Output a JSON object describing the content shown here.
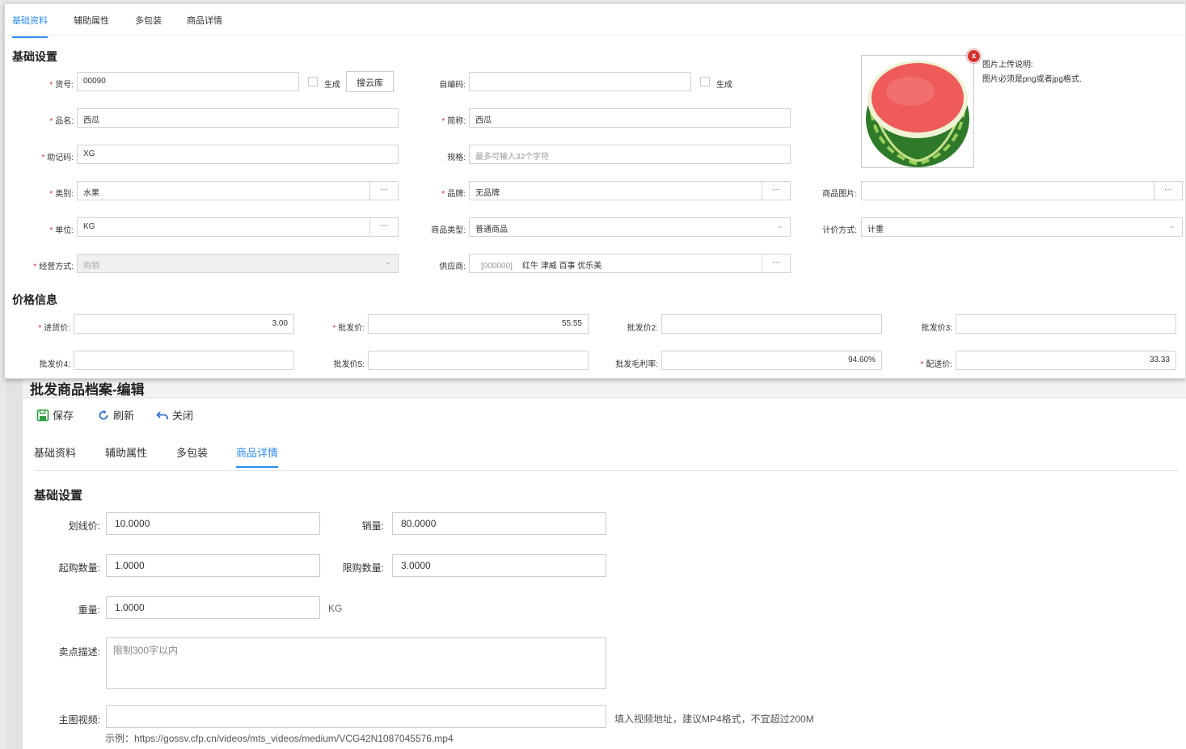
{
  "popup": {
    "tabs": [
      "基础资料",
      "辅助属性",
      "多包装",
      "商品详情"
    ],
    "active_tab": 0,
    "section_basic": "基础设置",
    "section_price": "价格信息",
    "fields": {
      "huohao": {
        "label": "货号:",
        "value": "00090",
        "required": true
      },
      "shengcheng1": "生成",
      "souyunku": "搜云库",
      "zibianma": {
        "label": "自编码:",
        "value": ""
      },
      "shengcheng2": "生成",
      "pinming": {
        "label": "品名:",
        "value": "西瓜",
        "required": true
      },
      "jiancheng": {
        "label": "简称:",
        "value": "西瓜",
        "required": true
      },
      "zhujima": {
        "label": "助记码:",
        "value": "XG",
        "required": true
      },
      "guige": {
        "label": "规格:",
        "placeholder": "最多可输入32个字符"
      },
      "leibie": {
        "label": "类别:",
        "value": "水果",
        "required": true
      },
      "pinpai": {
        "label": "品牌:",
        "value": "无品牌",
        "required": true
      },
      "shangpintupian": {
        "label": "商品图片:",
        "value": ""
      },
      "danwei": {
        "label": "单位:",
        "value": "KG",
        "required": true
      },
      "shangpinleixing": {
        "label": "商品类型:",
        "value": "普通商品"
      },
      "jijiafangshi": {
        "label": "计价方式:",
        "value": "计重"
      },
      "jingyingfangshi": {
        "label": "经营方式:",
        "value": "购销",
        "required": true
      },
      "gongyingshang": {
        "label": "供应商:",
        "code": "[000000]",
        "value": "红牛 津威 百事 优乐美"
      },
      "dots": "···"
    },
    "prices": {
      "jinhuojia": {
        "label": "进货价:",
        "value": "3.00",
        "required": true
      },
      "pifajia": {
        "label": "批发价:",
        "value": "55.55",
        "required": true
      },
      "pifajia2": {
        "label": "批发价2:",
        "value": ""
      },
      "pifajia3": {
        "label": "批发价3:",
        "value": ""
      },
      "pifajia4": {
        "label": "批发价4:",
        "value": ""
      },
      "pifajia5": {
        "label": "批发价5:",
        "value": ""
      },
      "maolilv": {
        "label": "批发毛利率:",
        "value": "94.60%"
      },
      "peisongjia": {
        "label": "配送价:",
        "value": "33.33",
        "required": true
      }
    },
    "image_note_title": "图片上传说明:",
    "image_note_text": "图片必须是png或者jpg格式.",
    "delete_icon": "x"
  },
  "bottom": {
    "title": "批发商品档案-编辑",
    "toolbar": {
      "save": "保存",
      "refresh": "刷新",
      "close": "关闭"
    },
    "tabs": [
      "基础资料",
      "辅助属性",
      "多包装",
      "商品详情"
    ],
    "active_tab": 3,
    "section": "基础设置",
    "fields": {
      "huaxianjia": {
        "label": "划线价:",
        "value": "10.0000"
      },
      "xiaoliang": {
        "label": "销量:",
        "value": "80.0000"
      },
      "qigoushuliang": {
        "label": "起购数量:",
        "value": "1.0000"
      },
      "xiangoushuliang": {
        "label": "限购数量:",
        "value": "3.0000"
      },
      "zhongliang": {
        "label": "重量:",
        "value": "1.0000",
        "unit": "KG"
      },
      "maidianmiaoshu": {
        "label": "卖点描述:",
        "placeholder": "限制300字以内"
      },
      "zhutushipin": {
        "label": "主图视频:",
        "value": "",
        "hint": "填入视频地址，建议MP4格式，不宜超过200M",
        "example": "示例：https://gossv.cfp.cn/videos/mts_videos/medium/VCG42N1087045576.mp4"
      }
    }
  },
  "colors": {
    "accent": "#2d8cf0",
    "required": "#e02b2b",
    "save_icon": "#2e9e44",
    "refresh_icon": "#2d6fc7"
  }
}
